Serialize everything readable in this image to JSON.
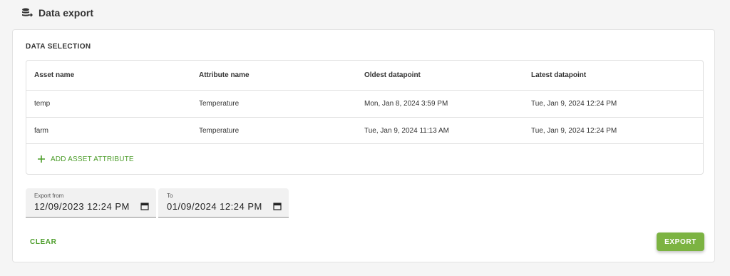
{
  "page": {
    "title": "Data export",
    "title_icon": "database-export-icon"
  },
  "selection": {
    "title": "DATA SELECTION",
    "columns": [
      "Asset name",
      "Attribute name",
      "Oldest datapoint",
      "Latest datapoint"
    ],
    "rows": [
      [
        "temp",
        "Temperature",
        "Mon, Jan 8, 2024 3:59 PM",
        "Tue, Jan 9, 2024 12:24 PM"
      ],
      [
        "farm",
        "Temperature",
        "Tue, Jan 9, 2024 11:13 AM",
        "Tue, Jan 9, 2024 12:24 PM"
      ]
    ],
    "add_label": "ADD ASSET ATTRIBUTE"
  },
  "range": {
    "from_label": "Export from",
    "from_value": "12/09/2023 12:24 PM",
    "to_label": "To",
    "to_value": "01/09/2024 12:24 PM"
  },
  "actions": {
    "clear_label": "CLEAR",
    "export_label": "EXPORT"
  },
  "colors": {
    "accent": "#4c9d2a",
    "button": "#7cb342"
  }
}
